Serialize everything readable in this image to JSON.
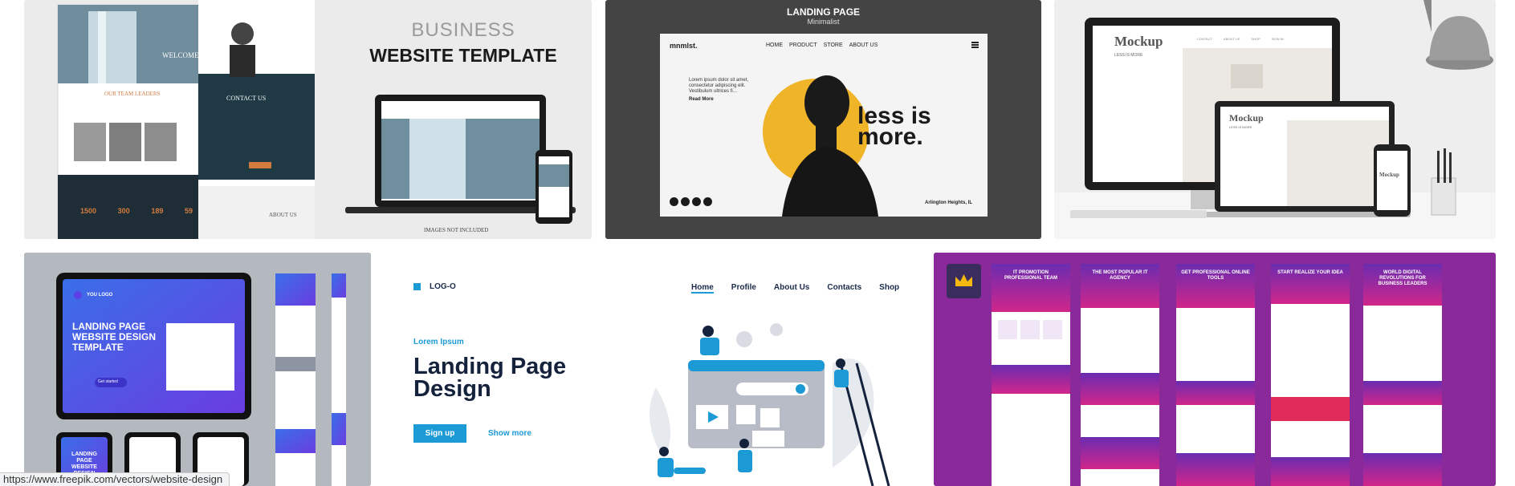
{
  "status_bar": {
    "url": "https://www.freepik.com/vectors/website-design"
  },
  "card_business": {
    "title_light": "BUSINESS",
    "title_bold": "WEBSITE TEMPLATE",
    "welcome": "WELCOME TO",
    "team_heading": "OUR TEAM LEADERS",
    "contact": "CONTACT US",
    "about": "ABOUT US",
    "note": "IMAGES NOT INCLUDED",
    "stats": [
      "1500",
      "300",
      "189",
      "59"
    ]
  },
  "card_minimal": {
    "title": "LANDING PAGE",
    "subtitle": "Minimalist",
    "logo": "mnmlst.",
    "nav": [
      "HOME",
      "PRODUCT",
      "STORE",
      "ABOUT US"
    ],
    "lorem": "Lorem ipsum dolor sit amet, consectetur adipiscing elit. Vestibulum ultrices fi…",
    "read_more": "Read More",
    "headline_1": "less is",
    "headline_2": "more.",
    "location": "Arlington Heights, IL",
    "accent": "#f0b429"
  },
  "card_mockup": {
    "brand": "Mockup",
    "tagline": "LESS IS MORE",
    "nav": [
      "CONTACT",
      "ABOUT US",
      "SHOP",
      "SIGN IN"
    ]
  },
  "card_tablet": {
    "logo": "YOU LOGO",
    "headline": "LANDING PAGE WEBSITE DESIGN TEMPLATE",
    "button": "Get started",
    "phone_headline": "LANDING PAGE WEBSITE DESIGN TEMPLATE"
  },
  "card_logo": {
    "logo": "LOG-O",
    "nav": [
      "Home",
      "Profile",
      "About Us",
      "Contacts",
      "Shop"
    ],
    "eyebrow": "Lorem Ipsum",
    "headline_1": "Landing Page",
    "headline_2": "Design",
    "signup": "Sign up",
    "show_more": "Show more",
    "accent": "#1b9ad6"
  },
  "card_purple": {
    "badge_icon": "crown-icon",
    "pages": [
      {
        "title": "IT PROMOTION PROFESSIONAL TEAM"
      },
      {
        "title": "THE MOST POPULAR IT AGENCY"
      },
      {
        "title": "GET PROFESSIONAL ONLINE TOOLS"
      },
      {
        "title": "START REALIZE YOUR IDEA"
      },
      {
        "title": "WORLD DIGITAL REVOLUTIONS FOR BUSINESS LEADERS"
      }
    ]
  }
}
